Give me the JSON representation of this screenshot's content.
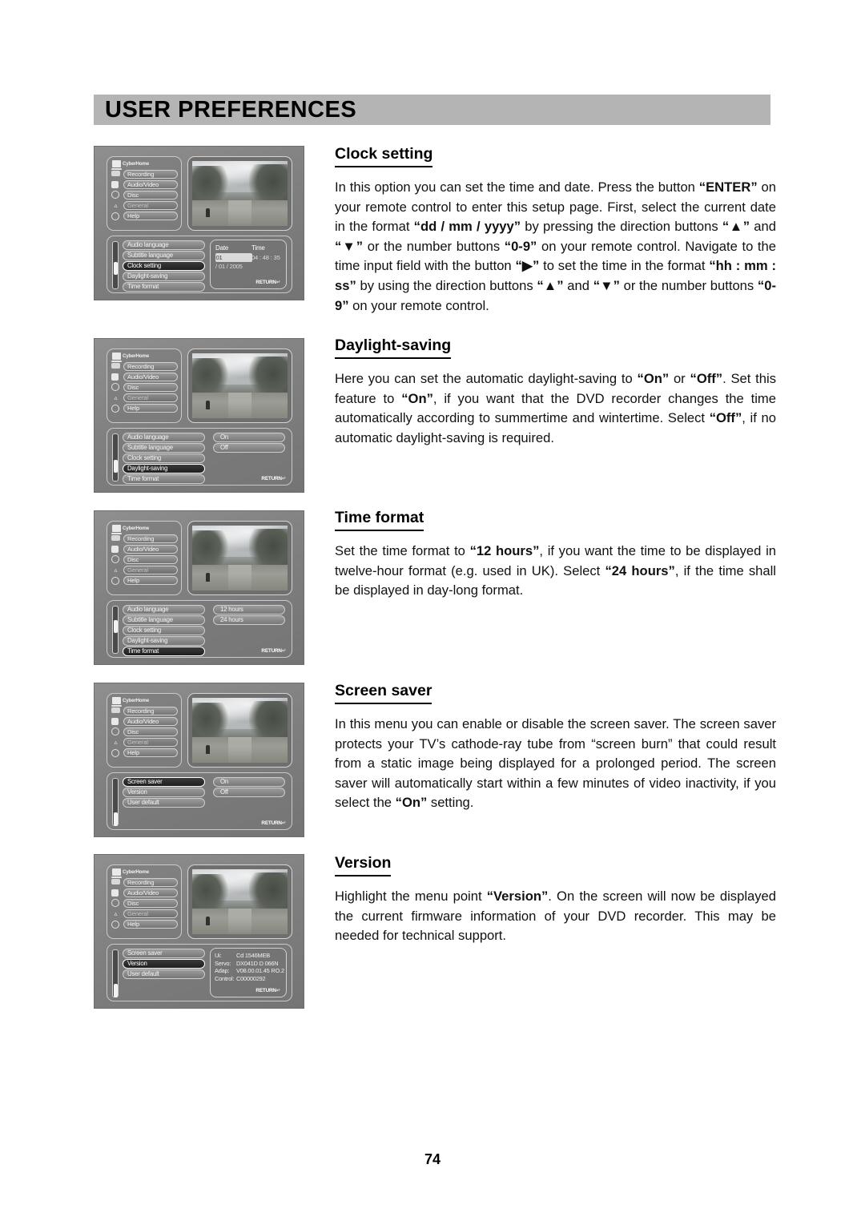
{
  "header": {
    "title": "USER PREFERENCES"
  },
  "page_number": "74",
  "osd": {
    "brand": "CyberHome",
    "nav": [
      {
        "label": "Recording",
        "icon": "recorder-icon",
        "dim": false
      },
      {
        "label": "Audio/Video",
        "icon": "monitor-icon",
        "dim": false
      },
      {
        "label": "Disc",
        "icon": "disc-icon",
        "dim": false
      },
      {
        "label": "General",
        "icon": "tool-icon",
        "dim": true
      },
      {
        "label": "Help",
        "icon": "question-icon",
        "dim": false
      }
    ],
    "return_label": "RETURN",
    "menu_a": [
      "Audio language",
      "Subtitle language",
      "Clock setting",
      "Daylight-saving",
      "Time format"
    ],
    "menu_b": [
      "Screen saver",
      "Version",
      "User default"
    ],
    "date_time": {
      "col_date": "Date",
      "col_time": "Time",
      "day": "01",
      "rest_date": " / 01 / 2005",
      "time_value": "04 : 48 : 35"
    },
    "onoff": [
      "On",
      "Off"
    ],
    "hours": [
      "12 hours",
      "24 hours"
    ],
    "version_info": [
      {
        "key": "Ui:",
        "value": "Cd 1546MEB"
      },
      {
        "key": "Servo:",
        "value": "DX041D D 066N"
      },
      {
        "key": "Adap:",
        "value": "V08.00.01.45 RO.2"
      },
      {
        "key": "Control:",
        "value": "C00000292"
      }
    ]
  },
  "sections": [
    {
      "id": "clock-setting",
      "heading": "Clock setting",
      "body_html": "In this option you can set the time and date. Press the button <b>“ENTER”</b> on your remote control to enter this setup page. First, select the current date in the format <b>“dd / mm / yyyy”</b> by pressing the direction buttons <b>“▲”</b> and <b>“▼”</b> or the number buttons <b>“0-9”</b> on your remote control. Navigate to the time input field with the button <b>“▶”</b> to set the time in the format <b>“hh : mm : ss”</b> by using the direction buttons <b>“▲”</b> and <b>“▼”</b> or the number buttons <b>“0-9”</b> on your remote control."
    },
    {
      "id": "daylight-saving",
      "heading": "Daylight-saving",
      "body_html": "Here you can set the automatic daylight-saving to <b>“On”</b> or <b>“Off”</b>. Set this feature to <b>“On”</b>, if you want that the DVD recorder changes the time automatically according to summertime and wintertime. Select <b>“Off”</b>, if no automatic daylight-saving is required."
    },
    {
      "id": "time-format",
      "heading": "Time format",
      "body_html": "Set the time format to <b>“12 hours”</b>, if you want the time to be displayed in twelve-hour format (e.g. used in UK). Select <b>“24 hours”</b>, if the time shall be displayed in day-long format."
    },
    {
      "id": "screen-saver",
      "heading": "Screen saver",
      "body_html": "In this menu you can enable or disable the screen saver. The screen saver protects your TV’s cathode-ray tube from “screen burn” that could result from a static image being displayed for a prolonged period. The screen saver will automatically start within a few minutes of video inactivity, if you select the <b>“On”</b> setting."
    },
    {
      "id": "version",
      "heading": "Version",
      "body_html": "Highlight the menu point <b>“Version”</b>. On the screen will now be displayed the current firmware information of your DVD recorder. This may be needed for technical support."
    }
  ]
}
